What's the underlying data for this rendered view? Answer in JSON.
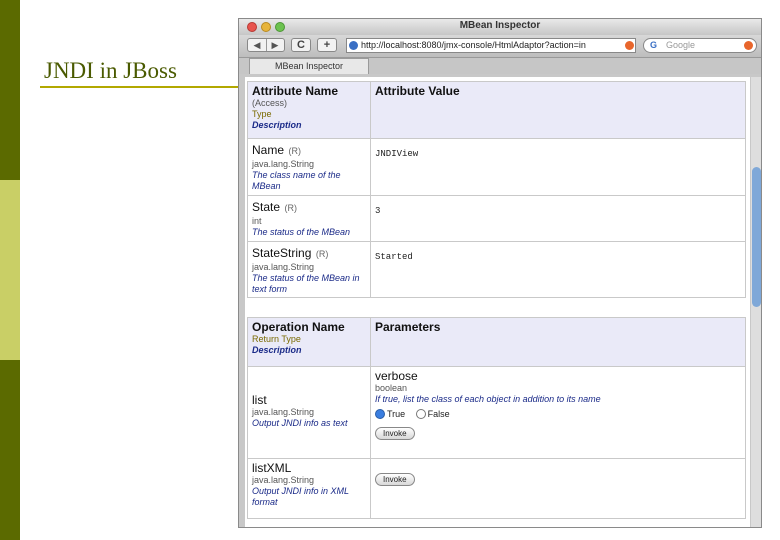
{
  "slide": {
    "title": "JNDI in JBoss",
    "colors": {
      "accent": "#b2a800",
      "bar_dark": "#5b6a00",
      "bar_light": "#c9cf66",
      "title": "#4a5a00"
    }
  },
  "browser": {
    "window_title": "MBean Inspector",
    "url": "http://localhost:8080/jmx-console/HtmlAdaptor?action=in",
    "search_placeholder": "Google",
    "search_engine_icon": "G",
    "back_icon": "◀",
    "forward_icon": "▶",
    "reload_icon": "C",
    "add_icon": "+",
    "tab_label": "MBean Inspector"
  },
  "attributes": {
    "header": {
      "col1": "Attribute Name",
      "access": "(Access)",
      "type": "Type",
      "description": "Description",
      "col2": "Attribute Value"
    },
    "rows": [
      {
        "name": "Name",
        "access": "(R)",
        "type": "java.lang.String",
        "description": "The class name of the MBean",
        "value": "JNDIView"
      },
      {
        "name": "State",
        "access": "(R)",
        "type": "int",
        "description": "The status of the MBean",
        "value": "3"
      },
      {
        "name": "StateString",
        "access": "(R)",
        "type": "java.lang.String",
        "description": "The status of the MBean in text form",
        "value": "Started"
      }
    ]
  },
  "operations": {
    "header": {
      "col1": "Operation Name",
      "return_type": "Return Type",
      "description": "Description",
      "col2": "Parameters"
    },
    "rows": [
      {
        "name": "list",
        "return_type": "java.lang.String",
        "description": "Output JNDI info as text",
        "param_name": "verbose",
        "param_type": "boolean",
        "param_description": "If true, list the class of each object in addition to its name",
        "option_true": "True",
        "option_false": "False",
        "selected": "True",
        "invoke": "Invoke"
      },
      {
        "name": "listXML",
        "return_type": "java.lang.String",
        "description": "Output JNDI info in XML format",
        "invoke": "Invoke"
      }
    ]
  }
}
